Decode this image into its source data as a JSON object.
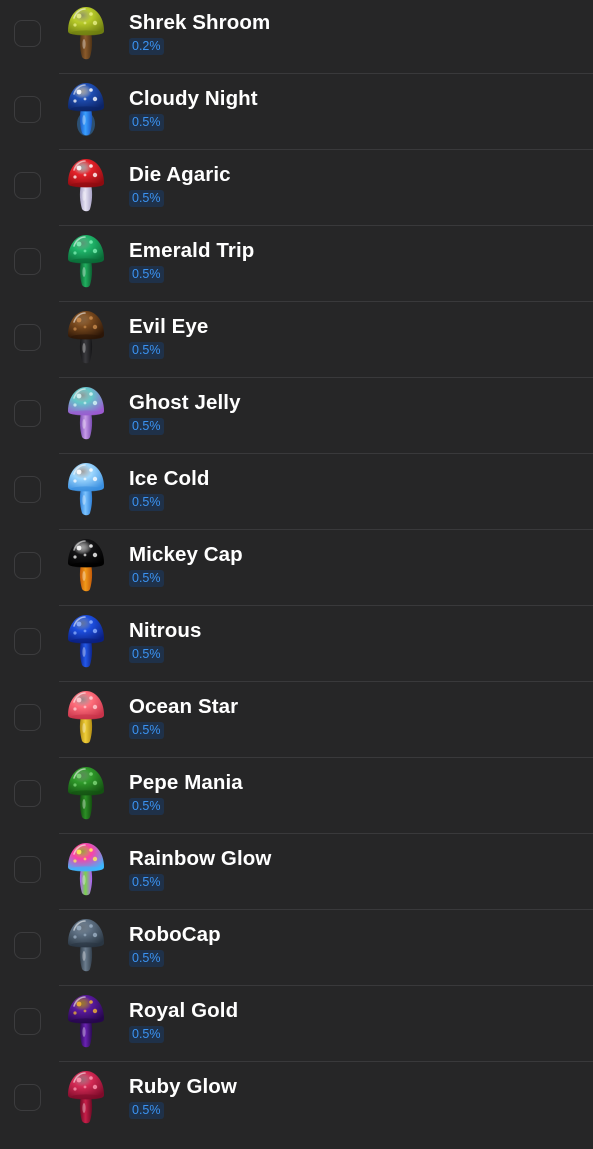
{
  "items": [
    {
      "name": "Shrek Shroom",
      "chance": "0.2%",
      "icon": "shrek-shroom-icon",
      "cap": "#b9cc2a",
      "cap_dark": "#6e7d10",
      "spot": "#e8f08a",
      "stem": "#8a5a2b",
      "stem_dark": "#4f3215",
      "glow": false
    },
    {
      "name": "Cloudy Night",
      "chance": "0.5%",
      "icon": "cloudy-night-icon",
      "cap": "#1f4fb5",
      "cap_dark": "#0c2466",
      "spot": "#ffffff",
      "stem": "#3aa0ff",
      "stem_dark": "#1a56c4",
      "glow": true
    },
    {
      "name": "Die Agaric",
      "chance": "0.5%",
      "icon": "die-agaric-icon",
      "cap": "#e5222a",
      "cap_dark": "#8e0b10",
      "spot": "#ffffff",
      "stem": "#e7e4f4",
      "stem_dark": "#a9a3c6",
      "glow": false
    },
    {
      "name": "Emerald Trip",
      "chance": "0.5%",
      "icon": "emerald-trip-icon",
      "cap": "#1fb56a",
      "cap_dark": "#0a6a37",
      "spot": "#7ff0b4",
      "stem": "#22b060",
      "stem_dark": "#0b6232",
      "glow": false
    },
    {
      "name": "Evil Eye",
      "chance": "0.5%",
      "icon": "evil-eye-icon",
      "cap": "#7a4a1e",
      "cap_dark": "#2c1607",
      "spot": "#c98b4c",
      "stem": "#3a3a3e",
      "stem_dark": "#151517",
      "glow": false
    },
    {
      "name": "Ghost Jelly",
      "chance": "0.5%",
      "icon": "ghost-jelly-icon",
      "cap": "#63c8c9",
      "cap_dark": "#9b5ad0",
      "spot": "#d8f6f6",
      "stem": "#c79be8",
      "stem_dark": "#7a4bb2",
      "glow": false
    },
    {
      "name": "Ice Cold",
      "chance": "0.5%",
      "icon": "ice-cold-icon",
      "cap": "#9fd8ff",
      "cap_dark": "#3a8fe0",
      "spot": "#ffffff",
      "stem": "#7cc4ff",
      "stem_dark": "#2f7fd6",
      "glow": false
    },
    {
      "name": "Mickey Cap",
      "chance": "0.5%",
      "icon": "mickey-cap-icon",
      "cap": "#141416",
      "cap_dark": "#000000",
      "spot": "#ffffff",
      "stem": "#f29a1a",
      "stem_dark": "#c45a08",
      "glow": false
    },
    {
      "name": "Nitrous",
      "chance": "0.5%",
      "icon": "nitrous-icon",
      "cap": "#1d4fe0",
      "cap_dark": "#0a1f80",
      "spot": "#8fb0ff",
      "stem": "#2459e8",
      "stem_dark": "#0c2590",
      "glow": false
    },
    {
      "name": "Ocean Star",
      "chance": "0.5%",
      "icon": "ocean-star-icon",
      "cap": "#ff6f7c",
      "cap_dark": "#c8334a",
      "spot": "#ffd1d6",
      "stem": "#f0cf3a",
      "stem_dark": "#b48e12",
      "glow": false
    },
    {
      "name": "Pepe Mania",
      "chance": "0.5%",
      "icon": "pepe-mania-icon",
      "cap": "#2f9a2a",
      "cap_dark": "#145212",
      "spot": "#7fd87a",
      "stem": "#2c8f26",
      "stem_dark": "#13500f",
      "glow": false
    },
    {
      "name": "Rainbow Glow",
      "chance": "0.5%",
      "icon": "rainbow-glow-icon",
      "cap": "#ff3fa6",
      "cap_dark": "#3ab8ff",
      "spot": "#fff15a",
      "stem": "#7ad44a",
      "stem_dark": "#b05cff",
      "glow": false
    },
    {
      "name": "RoboCap",
      "chance": "0.5%",
      "icon": "robocap-icon",
      "cap": "#5d6f82",
      "cap_dark": "#2a3642",
      "spot": "#9cb0c4",
      "stem": "#6c7d8f",
      "stem_dark": "#33404d",
      "glow": false
    },
    {
      "name": "Royal Gold",
      "chance": "0.5%",
      "icon": "royal-gold-icon",
      "cap": "#5a1a9e",
      "cap_dark": "#26064d",
      "spot": "#f2b533",
      "stem": "#6a23b3",
      "stem_dark": "#2b0a55",
      "glow": false
    },
    {
      "name": "Ruby Glow",
      "chance": "0.5%",
      "icon": "ruby-glow-icon",
      "cap": "#d42a55",
      "cap_dark": "#7e0b2a",
      "spot": "#ff9ab4",
      "stem": "#c81f4a",
      "stem_dark": "#6d0a24",
      "glow": false
    }
  ]
}
